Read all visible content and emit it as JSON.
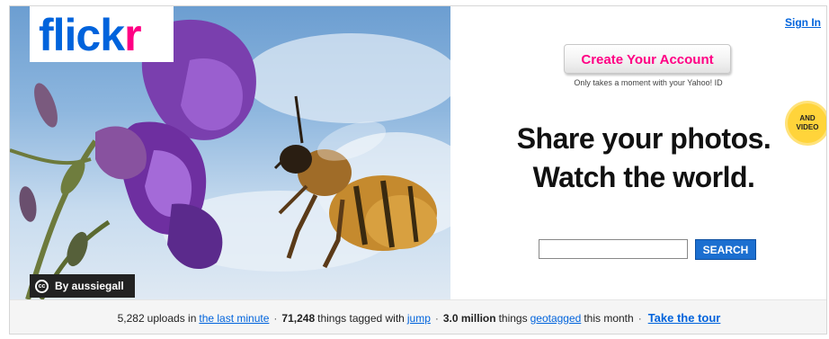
{
  "brand": {
    "logo_part1": "flick",
    "logo_part2": "r",
    "blue": "#0063dc",
    "pink": "#ff0084"
  },
  "header": {
    "sign_in": "Sign In"
  },
  "hero": {
    "credit_icon": "creative-commons-icon",
    "credit": "By aussiegall"
  },
  "cta": {
    "create_account": "Create Your Account",
    "subtext": "Only takes a moment with your Yahoo! ID",
    "badge_line1": "AND",
    "badge_line2": "VIDEO"
  },
  "tagline": {
    "line1": "Share your photos.",
    "line2": "Watch the world."
  },
  "search": {
    "value": "",
    "button": "SEARCH"
  },
  "stats": {
    "uploads_count": "5,282",
    "uploads_text": "uploads in",
    "uploads_link": "the last minute",
    "tagged_count": "71,248",
    "tagged_text": "things tagged with",
    "tagged_link": "jump",
    "geo_count": "3.0 million",
    "geo_text": "things",
    "geo_link": "geotagged",
    "geo_suffix": "this month",
    "separator": "·",
    "tour_link": "Take the tour"
  }
}
